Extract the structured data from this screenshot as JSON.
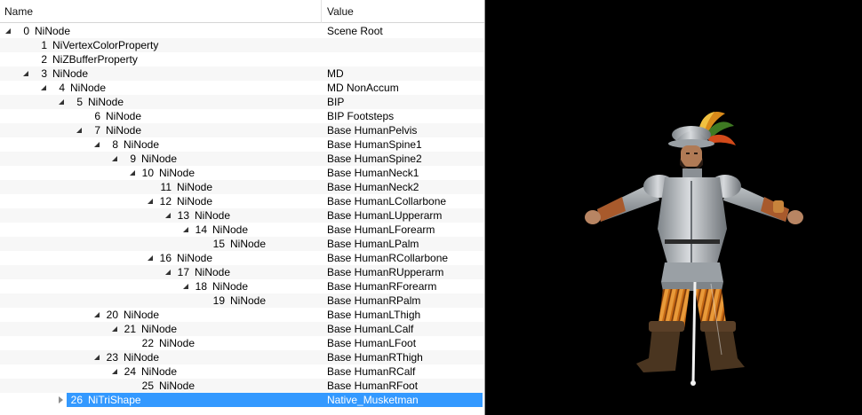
{
  "columns": {
    "name": "Name",
    "value": "Value"
  },
  "rows": [
    {
      "num": "0",
      "name": "NiNode",
      "value": "Scene Root",
      "toggle": "expanded"
    },
    {
      "num": "1",
      "name": "NiVertexColorProperty",
      "value": "",
      "toggle": "none"
    },
    {
      "num": "2",
      "name": "NiZBufferProperty",
      "value": "",
      "toggle": "none"
    },
    {
      "num": "3",
      "name": "NiNode",
      "value": "MD",
      "toggle": "expanded"
    },
    {
      "num": "4",
      "name": "NiNode",
      "value": "MD NonAccum",
      "toggle": "expanded"
    },
    {
      "num": "5",
      "name": "NiNode",
      "value": "BIP",
      "toggle": "expanded"
    },
    {
      "num": "6",
      "name": "NiNode",
      "value": "BIP Footsteps",
      "toggle": "none"
    },
    {
      "num": "7",
      "name": "NiNode",
      "value": "Base HumanPelvis",
      "toggle": "expanded"
    },
    {
      "num": "8",
      "name": "NiNode",
      "value": "Base HumanSpine1",
      "toggle": "expanded"
    },
    {
      "num": "9",
      "name": "NiNode",
      "value": "Base HumanSpine2",
      "toggle": "expanded"
    },
    {
      "num": "10",
      "name": "NiNode",
      "value": "Base HumanNeck1",
      "toggle": "expanded"
    },
    {
      "num": "11",
      "name": "NiNode",
      "value": "Base HumanNeck2",
      "toggle": "none"
    },
    {
      "num": "12",
      "name": "NiNode",
      "value": "Base HumanLCollarbone",
      "toggle": "expanded"
    },
    {
      "num": "13",
      "name": "NiNode",
      "value": "Base HumanLUpperarm",
      "toggle": "expanded"
    },
    {
      "num": "14",
      "name": "NiNode",
      "value": "Base HumanLForearm",
      "toggle": "expanded"
    },
    {
      "num": "15",
      "name": "NiNode",
      "value": "Base HumanLPalm",
      "toggle": "none"
    },
    {
      "num": "16",
      "name": "NiNode",
      "value": "Base HumanRCollarbone",
      "toggle": "expanded"
    },
    {
      "num": "17",
      "name": "NiNode",
      "value": "Base HumanRUpperarm",
      "toggle": "expanded"
    },
    {
      "num": "18",
      "name": "NiNode",
      "value": "Base HumanRForearm",
      "toggle": "expanded"
    },
    {
      "num": "19",
      "name": "NiNode",
      "value": "Base HumanRPalm",
      "toggle": "none"
    },
    {
      "num": "20",
      "name": "NiNode",
      "value": "Base HumanLThigh",
      "toggle": "expanded"
    },
    {
      "num": "21",
      "name": "NiNode",
      "value": "Base HumanLCalf",
      "toggle": "expanded"
    },
    {
      "num": "22",
      "name": "NiNode",
      "value": "Base HumanLFoot",
      "toggle": "none"
    },
    {
      "num": "23",
      "name": "NiNode",
      "value": "Base HumanRThigh",
      "toggle": "expanded"
    },
    {
      "num": "24",
      "name": "NiNode",
      "value": "Base HumanRCalf",
      "toggle": "expanded"
    },
    {
      "num": "25",
      "name": "NiNode",
      "value": "Base HumanRFoot",
      "toggle": "none"
    },
    {
      "num": "26",
      "name": "NiTriShape",
      "value": "Native_Musketman",
      "toggle": "collapsed",
      "selected": true
    }
  ],
  "viewport": {
    "model": "musketman-3d-model"
  },
  "colors": {
    "selection": "#3399ff",
    "viewport_bg": "#000000",
    "panel_bg": "#ffffff"
  }
}
